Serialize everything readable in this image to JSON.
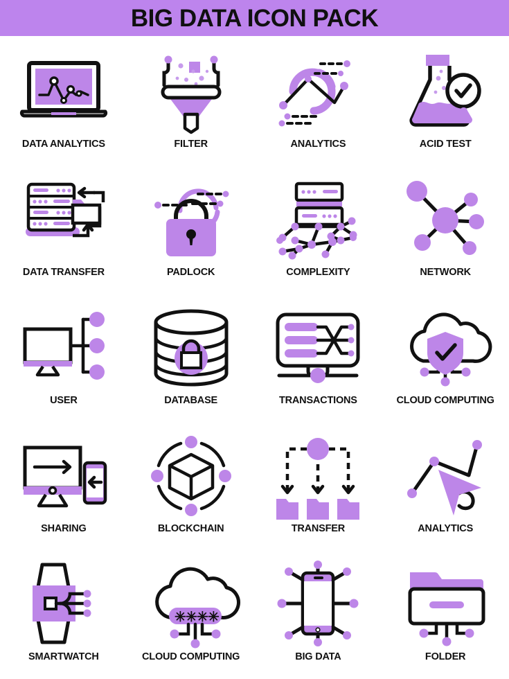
{
  "header": {
    "title": "BIG DATA ICON PACK",
    "background_color": "#bd84ed",
    "text_color": "#101010"
  },
  "palette": {
    "purple": "#bd86e8",
    "purple_light": "#c79bec",
    "black": "#111111",
    "white": "#ffffff"
  },
  "grid": {
    "columns": 4,
    "rows": 5,
    "total_icons": 20
  },
  "icons": [
    {
      "label": "DATA ANALYTICS",
      "icon_name": "laptop-line-chart-icon"
    },
    {
      "label": "FILTER",
      "icon_name": "funnel-filter-icon"
    },
    {
      "label": "ANALYTICS",
      "icon_name": "donut-chart-line-icon"
    },
    {
      "label": "ACID TEST",
      "icon_name": "flask-magnifier-check-icon"
    },
    {
      "label": "DATA TRANSFER",
      "icon_name": "server-folder-arrows-icon"
    },
    {
      "label": "PADLOCK",
      "icon_name": "padlock-icon"
    },
    {
      "label": "COMPLEXITY",
      "icon_name": "server-node-web-icon"
    },
    {
      "label": "NETWORK",
      "icon_name": "hub-network-icon"
    },
    {
      "label": "USER",
      "icon_name": "monitor-nodes-icon"
    },
    {
      "label": "DATABASE",
      "icon_name": "database-lock-icon"
    },
    {
      "label": "TRANSACTIONS",
      "icon_name": "crossing-lines-panel-icon"
    },
    {
      "label": "CLOUD COMPUTING",
      "icon_name": "cloud-shield-check-icon"
    },
    {
      "label": "SHARING",
      "icon_name": "monitor-phone-arrows-icon"
    },
    {
      "label": "BLOCKCHAIN",
      "icon_name": "cube-orbit-icon"
    },
    {
      "label": "TRANSFER",
      "icon_name": "dashed-arrows-folders-icon"
    },
    {
      "label": "ANALYTICS",
      "icon_name": "cursor-line-graph-icon"
    },
    {
      "label": "SMARTWATCH",
      "icon_name": "smartwatch-icon"
    },
    {
      "label": "CLOUD COMPUTING",
      "icon_name": "cloud-password-icon"
    },
    {
      "label": "BIG DATA",
      "icon_name": "phone-nodes-icon"
    },
    {
      "label": "FOLDER",
      "icon_name": "folder-nodes-icon"
    }
  ]
}
